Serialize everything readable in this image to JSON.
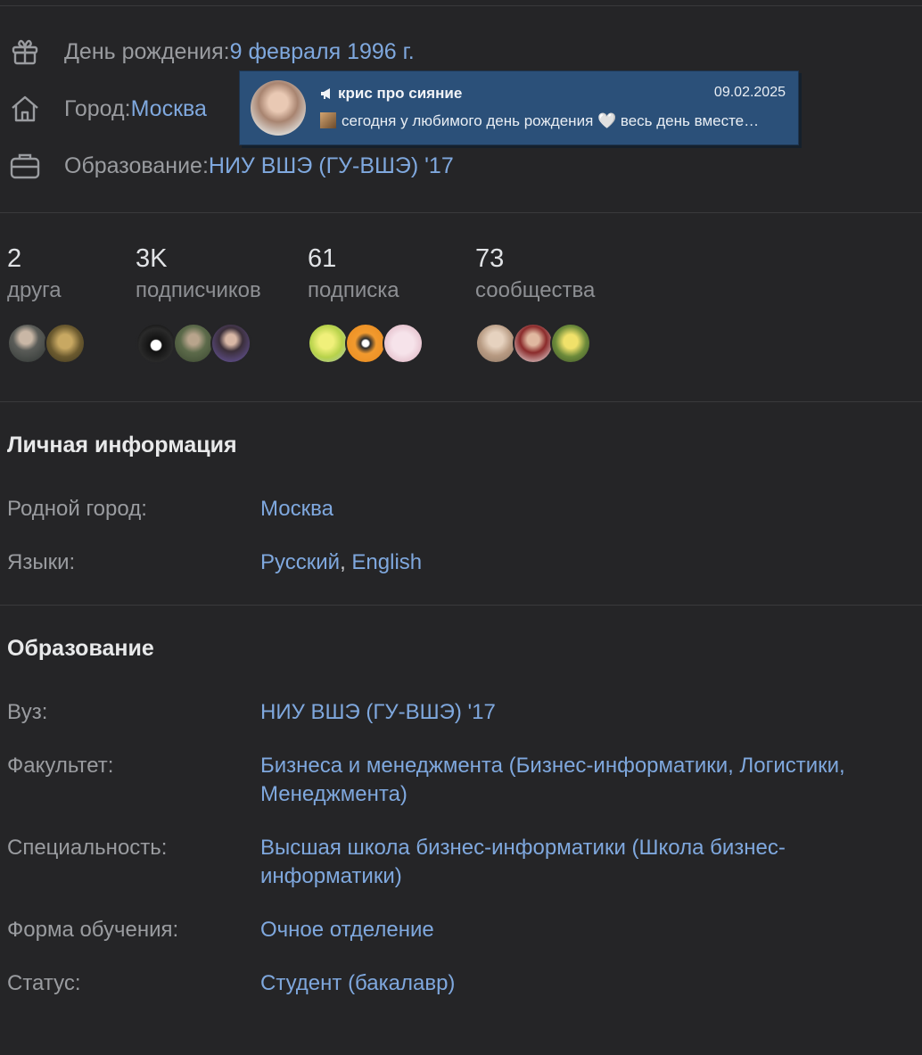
{
  "profile_info": {
    "birthday": {
      "label": "День рождения: ",
      "value": "9 февраля 1996 г."
    },
    "city": {
      "label": "Город: ",
      "value": "Москва"
    },
    "education": {
      "label": "Образование: ",
      "value": "НИУ ВШЭ (ГУ-ВШЭ) '17"
    }
  },
  "icons": {
    "birthday": "gift-icon",
    "city": "home-icon",
    "education": "briefcase-icon",
    "channel": "megaphone-icon"
  },
  "stats": [
    {
      "count": "2",
      "caption": "друга"
    },
    {
      "count": "3K",
      "caption": "подписчиков"
    },
    {
      "count": "61",
      "caption": "подписка"
    },
    {
      "count": "73",
      "caption": "сообщества"
    }
  ],
  "personal_info": {
    "title": "Личная информация",
    "rows": {
      "hometown": {
        "key": "Родной город:",
        "value": "Москва"
      },
      "languages": {
        "key": "Языки:",
        "lang1": "Русский",
        "sep": ", ",
        "lang2": "English"
      }
    }
  },
  "education_section": {
    "title": "Образование",
    "rows": {
      "university": {
        "key": "Вуз:",
        "value": "НИУ ВШЭ (ГУ-ВШЭ) '17"
      },
      "faculty": {
        "key": "Факультет:",
        "value": "Бизнеса и менеджмента (Бизнес-информатики, Логистики, Менеджмента)"
      },
      "specialty": {
        "key": "Специальность:",
        "value": "Высшая школа бизнес-информатики (Школа бизнес-информатики)"
      },
      "form": {
        "key": "Форма обучения:",
        "value": "Очное отделение"
      },
      "status": {
        "key": "Статус:",
        "value": "Студент (бакалавр)"
      }
    }
  },
  "notification": {
    "name": "крис про сияние",
    "date": "09.02.2025",
    "text": "сегодня у любимого день рождения 🤍  весь день вместе…"
  },
  "colors": {
    "background": "#252527",
    "link": "#7fa8de",
    "popup": "#2b5079"
  }
}
